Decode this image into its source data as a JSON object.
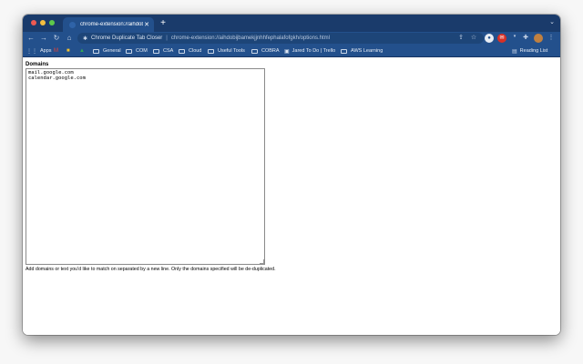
{
  "browser": {
    "tab": {
      "title": "chrome-extension://aihdobiji",
      "close_icon": "close-icon"
    },
    "new_tab_label": "+",
    "tab_menu_label": "⌄",
    "omnibox": {
      "site_name": "Chrome Duplicate Tab Closer",
      "separator": "|",
      "url": "chrome-extension://aihdobijbamekjjnhhfephalafofgkh/options.html"
    },
    "toolbar_icons": [
      "back-arrow-icon",
      "forward-arrow-icon",
      "reload-icon",
      "home-icon",
      "share-icon",
      "bookmark-star-icon",
      "extension-icon",
      "puzzle-icon",
      "profile-avatar",
      "menu-icon"
    ],
    "bookmarks": [
      {
        "label": "Apps",
        "icon": "apps-grid-icon"
      },
      {
        "label": "",
        "icon": "gmail-icon"
      },
      {
        "label": "",
        "icon": "bookmark-icon"
      },
      {
        "label": "",
        "icon": "drive-icon"
      },
      {
        "label": "General",
        "icon": "folder-icon"
      },
      {
        "label": "COM",
        "icon": "folder-icon"
      },
      {
        "label": "CSA",
        "icon": "folder-icon"
      },
      {
        "label": "Cloud",
        "icon": "folder-icon"
      },
      {
        "label": "Useful Tools",
        "icon": "folder-icon"
      },
      {
        "label": "COBRA",
        "icon": "folder-icon"
      },
      {
        "label": "Jared To Do | Trello",
        "icon": "trello-icon"
      },
      {
        "label": "AWS Learning",
        "icon": "folder-icon"
      }
    ],
    "reading_list": "Reading List"
  },
  "page": {
    "domains_label": "Domains",
    "domains_value": "mail.google.com\ncalendar.google.com",
    "help_text": "Add domains or text you'd like to match on separated by a new line. Only the domains specified will be de-duplicated."
  }
}
